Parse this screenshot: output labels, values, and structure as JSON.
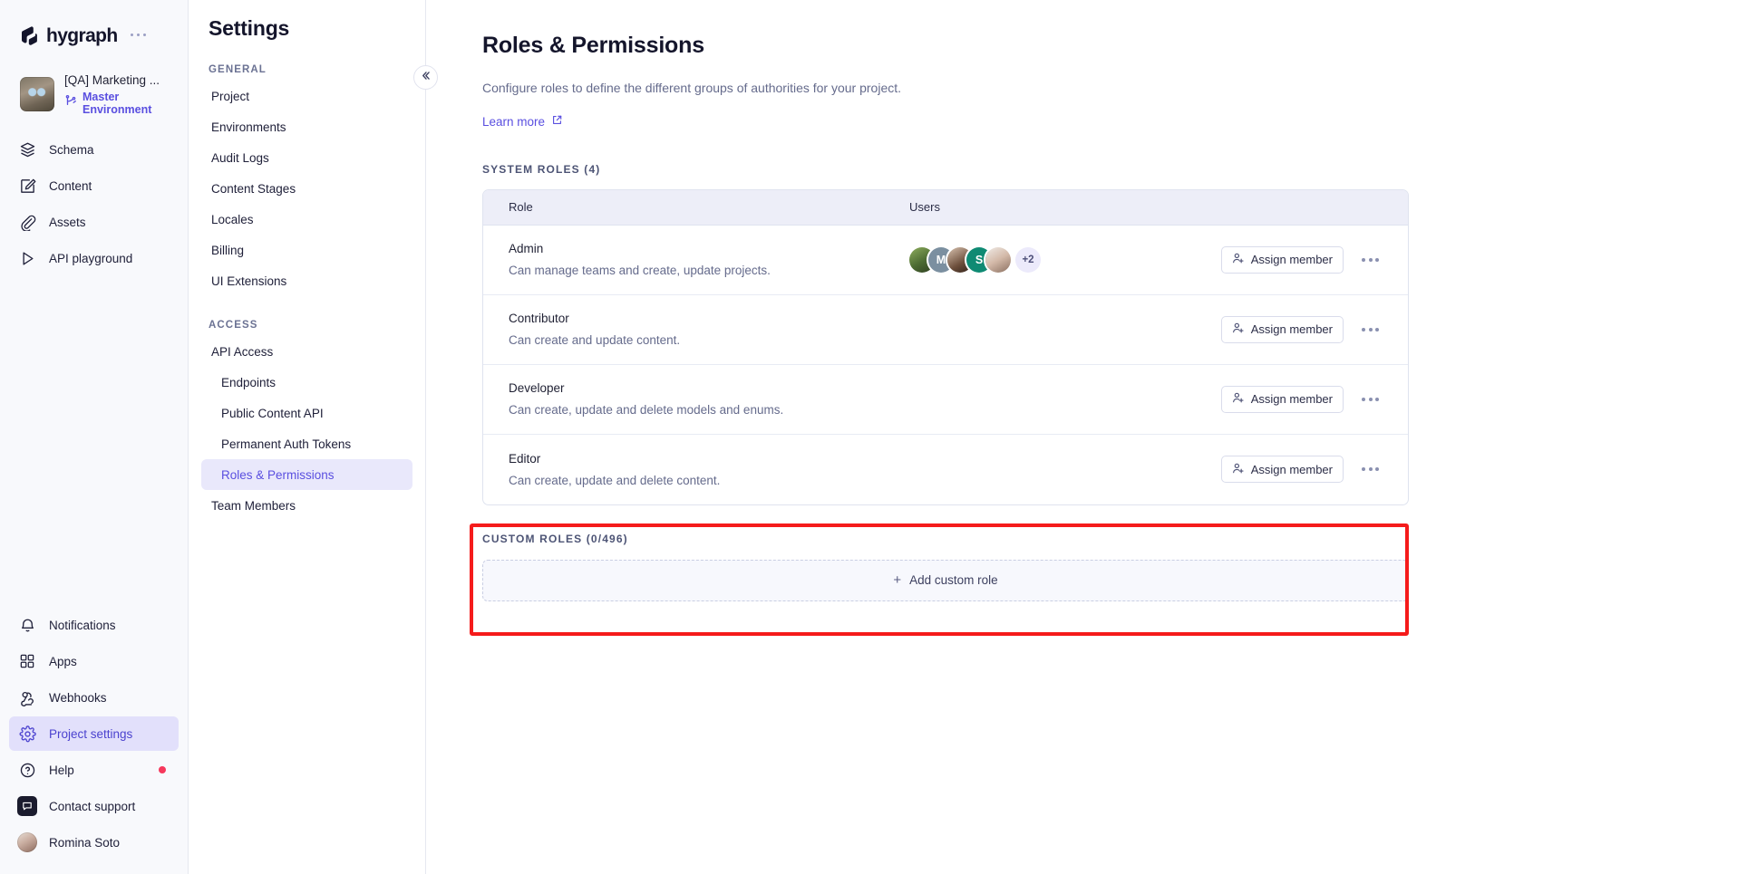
{
  "brand": {
    "name": "hygraph",
    "overflow_icon": "ellipsis-icon"
  },
  "project": {
    "name": "[QA] Marketing ...",
    "environment": "Master Environment",
    "env_icon": "branch-icon",
    "thumb_icon": "project-thumbnail"
  },
  "rail": {
    "primary": [
      {
        "label": "Schema",
        "icon": "layers-icon",
        "active": false
      },
      {
        "label": "Content",
        "icon": "edit-square-icon",
        "active": false
      },
      {
        "label": "Assets",
        "icon": "paperclip-icon",
        "active": false
      },
      {
        "label": "API playground",
        "icon": "play-triangle-icon",
        "active": false
      }
    ],
    "secondary": [
      {
        "label": "Notifications",
        "icon": "bell-icon",
        "active": false
      },
      {
        "label": "Apps",
        "icon": "grid-icon",
        "active": false
      },
      {
        "label": "Webhooks",
        "icon": "webhook-icon",
        "active": false
      },
      {
        "label": "Project settings",
        "icon": "gear-icon",
        "active": true
      },
      {
        "label": "Help",
        "icon": "question-circle-icon",
        "active": false,
        "badge": true
      },
      {
        "label": "Contact support",
        "icon": "chat-bubble-icon",
        "active": false
      },
      {
        "label": "Romina Soto",
        "icon": "user-avatar",
        "active": false
      }
    ]
  },
  "settings": {
    "title": "Settings",
    "sections": [
      {
        "label": "GENERAL",
        "items": [
          {
            "label": "Project",
            "active": false,
            "sub": false
          },
          {
            "label": "Environments",
            "active": false,
            "sub": false
          },
          {
            "label": "Audit Logs",
            "active": false,
            "sub": false
          },
          {
            "label": "Content Stages",
            "active": false,
            "sub": false
          },
          {
            "label": "Locales",
            "active": false,
            "sub": false
          },
          {
            "label": "Billing",
            "active": false,
            "sub": false
          },
          {
            "label": "UI Extensions",
            "active": false,
            "sub": false
          }
        ]
      },
      {
        "label": "ACCESS",
        "items": [
          {
            "label": "API Access",
            "active": false,
            "sub": false
          },
          {
            "label": "Endpoints",
            "active": false,
            "sub": true
          },
          {
            "label": "Public Content API",
            "active": false,
            "sub": true
          },
          {
            "label": "Permanent Auth Tokens",
            "active": false,
            "sub": true
          },
          {
            "label": "Roles & Permissions",
            "active": true,
            "sub": true
          },
          {
            "label": "Team Members",
            "active": false,
            "sub": false
          }
        ]
      }
    ],
    "collapse_icon": "chevron-double-left-icon"
  },
  "main": {
    "title": "Roles & Permissions",
    "subtitle": "Configure roles to define the different groups of authorities for your project.",
    "learn_more": "Learn more",
    "learn_more_icon": "external-link-icon",
    "system_roles_label": "SYSTEM ROLES (4)",
    "columns": {
      "role": "Role",
      "users": "Users"
    },
    "assign_label": "Assign member",
    "assign_icon": "user-plus-icon",
    "kebab_icon": "ellipsis-icon",
    "rows": [
      {
        "name": "Admin",
        "description": "Can manage teams and create, update projects.",
        "avatars": [
          {
            "kind": "photo",
            "color": "#6d8a4e",
            "initial": ""
          },
          {
            "kind": "initial",
            "color": "#7b8fa0",
            "initial": "M"
          },
          {
            "kind": "photo",
            "color": "#5a4437",
            "initial": ""
          },
          {
            "kind": "initial",
            "color": "#0f8a73",
            "initial": "S"
          },
          {
            "kind": "photo",
            "color": "#c9b6a8",
            "initial": ""
          }
        ],
        "overflow": "+2"
      },
      {
        "name": "Contributor",
        "description": "Can create and update content.",
        "avatars": [],
        "overflow": ""
      },
      {
        "name": "Developer",
        "description": "Can create, update and delete models and enums.",
        "avatars": [],
        "overflow": ""
      },
      {
        "name": "Editor",
        "description": "Can create, update and delete content.",
        "avatars": [],
        "overflow": ""
      }
    ],
    "custom_roles_label": "CUSTOM ROLES (0/496)",
    "add_custom_role": "Add custom role",
    "add_icon": "plus-icon"
  },
  "colors": {
    "accent": "#5a4fe0",
    "highlight_box": "#f51b1b",
    "badge": "#f6385c",
    "table_header_bg": "#edeef8"
  }
}
